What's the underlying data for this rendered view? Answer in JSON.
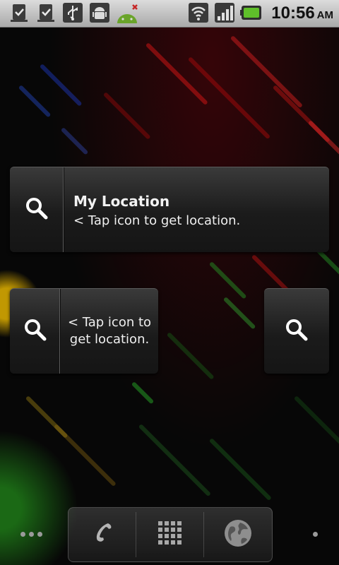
{
  "status_bar": {
    "time": "10:56",
    "ampm": "AM",
    "icons": [
      "clipboard-check-icon",
      "clipboard-check-icon",
      "usb-icon",
      "android-debug-icon",
      "android-no-connection-icon",
      "wifi-icon",
      "signal-icon",
      "battery-icon"
    ]
  },
  "widget_large": {
    "title": "My Location",
    "text": "< Tap icon to get location."
  },
  "widget_medium": {
    "line1": "< Tap icon to",
    "line2": "get location."
  },
  "dock": {
    "items": [
      "phone-icon",
      "app-drawer-icon",
      "browser-globe-icon"
    ]
  },
  "colors": {
    "status_bar": "#c4c4c4",
    "battery": "#5fbf2a",
    "widget": "#262626"
  }
}
